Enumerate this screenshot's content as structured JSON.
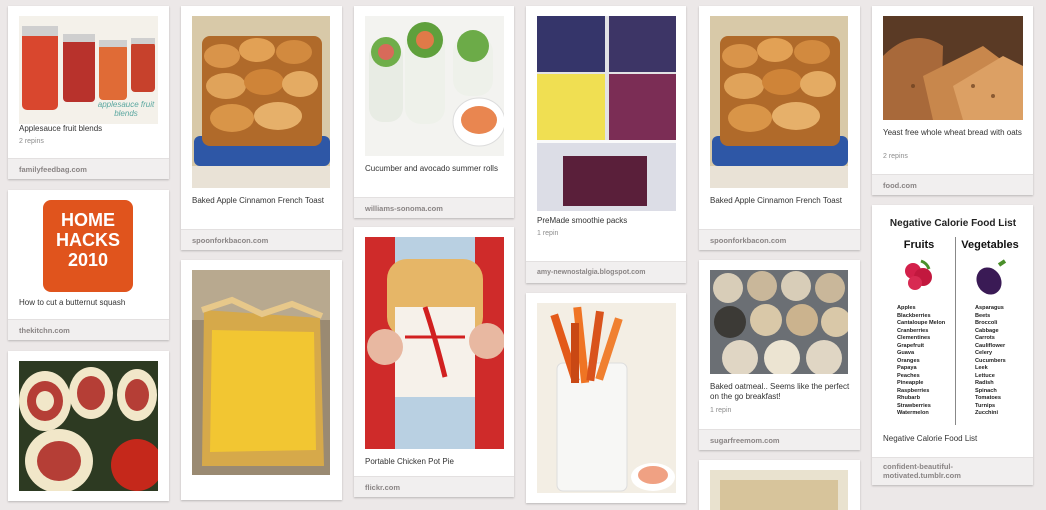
{
  "pins": [
    {
      "key": "applesauce",
      "description": "Applesauce fruit blends",
      "repins": "2 repins",
      "source": "familyfeedbag.com",
      "image_text": "applesauce fruit blends"
    },
    {
      "key": "home-hacks",
      "description": "How to cut a butternut squash",
      "repins": "",
      "source": "thekitchn.com",
      "image_text": "HOME HACKS 2010"
    },
    {
      "key": "pinwheels",
      "description": "",
      "repins": "",
      "source": ""
    },
    {
      "key": "french-toast-1",
      "description": "Baked Apple Cinnamon French Toast",
      "repins": "",
      "source": "spoonforkbacon.com"
    },
    {
      "key": "custard",
      "description": "",
      "repins": "",
      "source": ""
    },
    {
      "key": "summer-rolls",
      "description": "Cucumber and avocado summer rolls",
      "repins": "",
      "source": "williams-sonoma.com"
    },
    {
      "key": "pot-pie",
      "description": "Portable Chicken Pot Pie",
      "repins": "",
      "source": "flickr.com"
    },
    {
      "key": "smoothie",
      "description": "PreMade smoothie packs",
      "repins": "1 repin",
      "source": "amy-newnostalgia.blogspot.com"
    },
    {
      "key": "fries",
      "description": "",
      "repins": "",
      "source": ""
    },
    {
      "key": "french-toast-2",
      "description": "Baked Apple Cinnamon French Toast",
      "repins": "",
      "source": "spoonforkbacon.com"
    },
    {
      "key": "oatmeal",
      "description": "Baked oatmeal.. Seems like the perfect on the go breakfast!",
      "repins": "1 repin",
      "source": "sugarfreemom.com"
    },
    {
      "key": "bottom-peek",
      "description": "",
      "repins": "",
      "source": ""
    },
    {
      "key": "bread",
      "description": "Yeast free whole wheat bread with oats",
      "repins": "2 repins",
      "source": "food.com"
    },
    {
      "key": "neg-cal",
      "description": "Negative Calorie Food List",
      "repins": "",
      "source": "confident-beautiful-motivated.tumblr.com"
    }
  ],
  "negative_calorie_chart": {
    "title": "Negative Calorie Food List",
    "fruits_heading": "Fruits",
    "vegetables_heading": "Vegetables",
    "fruits": [
      "Apples",
      "Blackberries",
      "Cantaloupe Melon",
      "Cranberries",
      "Clementines",
      "Grapefruit",
      "Guava",
      "Oranges",
      "Papaya",
      "Peaches",
      "Pineapple",
      "Raspberries",
      "Rhubarb",
      "Strawberries",
      "Watermelon"
    ],
    "vegetables": [
      "Asparagus",
      "Beets",
      "Broccoli",
      "Cabbage",
      "Carrots",
      "Cauliflower",
      "Celery",
      "Cucumbers",
      "Leek",
      "Lettuce",
      "Radish",
      "Spinach",
      "Tomatoes",
      "Turnips",
      "Zucchini"
    ]
  }
}
